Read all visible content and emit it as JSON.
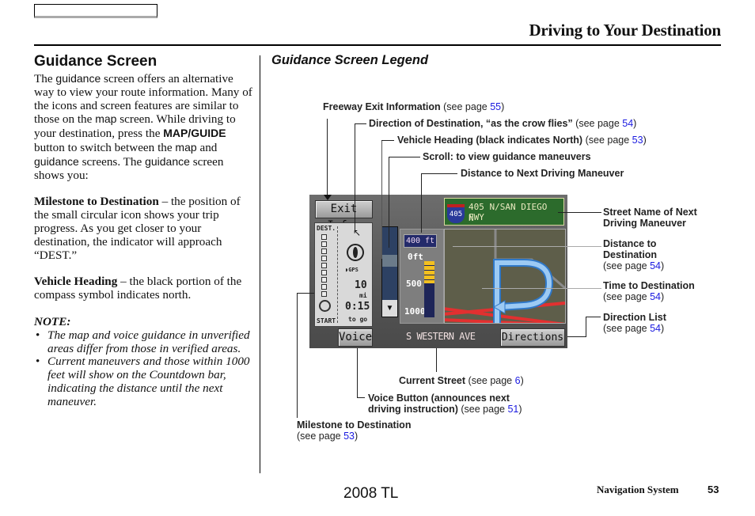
{
  "header": {
    "chapter_title": "Driving to Your Destination"
  },
  "section": {
    "title": "Guidance Screen",
    "intro": [
      {
        "t": "The ",
        "s": "serif"
      },
      {
        "t": "guidance",
        "s": "sans"
      },
      {
        "t": " screen offers an alternative way to view your route information. Many of the icons and screen features are similar to those on the ",
        "s": "serif"
      },
      {
        "t": "map",
        "s": "sans"
      },
      {
        "t": " screen. While driving to your destination, press the ",
        "s": "serif"
      },
      {
        "t": "MAP/GUIDE",
        "s": "sansb"
      },
      {
        "t": " button to switch between the ",
        "s": "serif"
      },
      {
        "t": "map",
        "s": "sans"
      },
      {
        "t": " and ",
        "s": "serif"
      },
      {
        "t": "guidance",
        "s": "sans"
      },
      {
        "t": " screens. The ",
        "s": "serif"
      },
      {
        "t": "guidance",
        "s": "sans"
      },
      {
        "t": " screen shows you:",
        "s": "serif"
      }
    ],
    "milestone": {
      "term": "Milestone to Destination",
      "desc": " – the position of the small circular icon shows your trip progress. As you get closer to your destination, the indicator will approach “DEST.”"
    },
    "heading": {
      "term": "Vehicle Heading",
      "desc": " – the black portion of the compass symbol indicates north."
    },
    "note_label": "NOTE:",
    "notes": [
      "The map and voice guidance in unverified areas differ from those in verified areas.",
      "Current maneuvers and those within 1000 feet will show on the Countdown bar, indicating the distance until the next maneuver."
    ]
  },
  "legend": {
    "title": "Guidance Screen Legend",
    "see_page": "(see page ",
    "items": {
      "freeway_exit": {
        "label": "Freeway Exit Information",
        "page": "55"
      },
      "direction_dest": {
        "label": "Direction of Destination, “as the crow flies”",
        "page": "54"
      },
      "vehicle_heading": {
        "label": "Vehicle Heading (black indicates North)",
        "page": "53"
      },
      "scroll": {
        "label": "Scroll: to view guidance maneuvers"
      },
      "distance_next": {
        "label": "Distance to Next Driving Maneuver"
      },
      "street_next": {
        "label1": "Street Name of Next",
        "label2": "Driving Maneuver"
      },
      "distance_dest": {
        "label1": "Distance to",
        "label2": "Destination",
        "page": "54"
      },
      "time_dest": {
        "label": "Time to Destination",
        "page": "54"
      },
      "direction_list": {
        "label": "Direction List",
        "page": "54"
      },
      "current_street": {
        "label": "Current Street",
        "page": "6"
      },
      "voice_button": {
        "label1": "Voice Button (announces next",
        "label2": "driving instruction)",
        "page": "51"
      },
      "milestone": {
        "label": "Milestone to Destination",
        "page": "53"
      }
    }
  },
  "screen": {
    "exit_info_button": "Exit Info.",
    "voice_button": "Voice",
    "directions_button": "Directions",
    "current_street": "S WESTERN AVE",
    "freeway_shield": "405",
    "sign_line1": "405 N/SAN DIEGO FWY",
    "sign_line2": "N",
    "dest_label": "DEST.",
    "start_label": "START",
    "gps_label": "GPS",
    "distance_value": "10",
    "distance_unit": "mi",
    "time_value": "0:15",
    "time_suffix": "to go",
    "next_distance": "400 ft",
    "scale": [
      "0ft",
      "500",
      "1000"
    ],
    "countdown_fraction": 0.4,
    "colors": {
      "sign_green": "#2c6b2c",
      "route_blue": "#7fb8f0",
      "road_red": "#e23030",
      "countdown_yellow": "#f2c020"
    }
  },
  "footer": {
    "model": "2008  TL",
    "manual": "Navigation System",
    "page_number": "53"
  }
}
